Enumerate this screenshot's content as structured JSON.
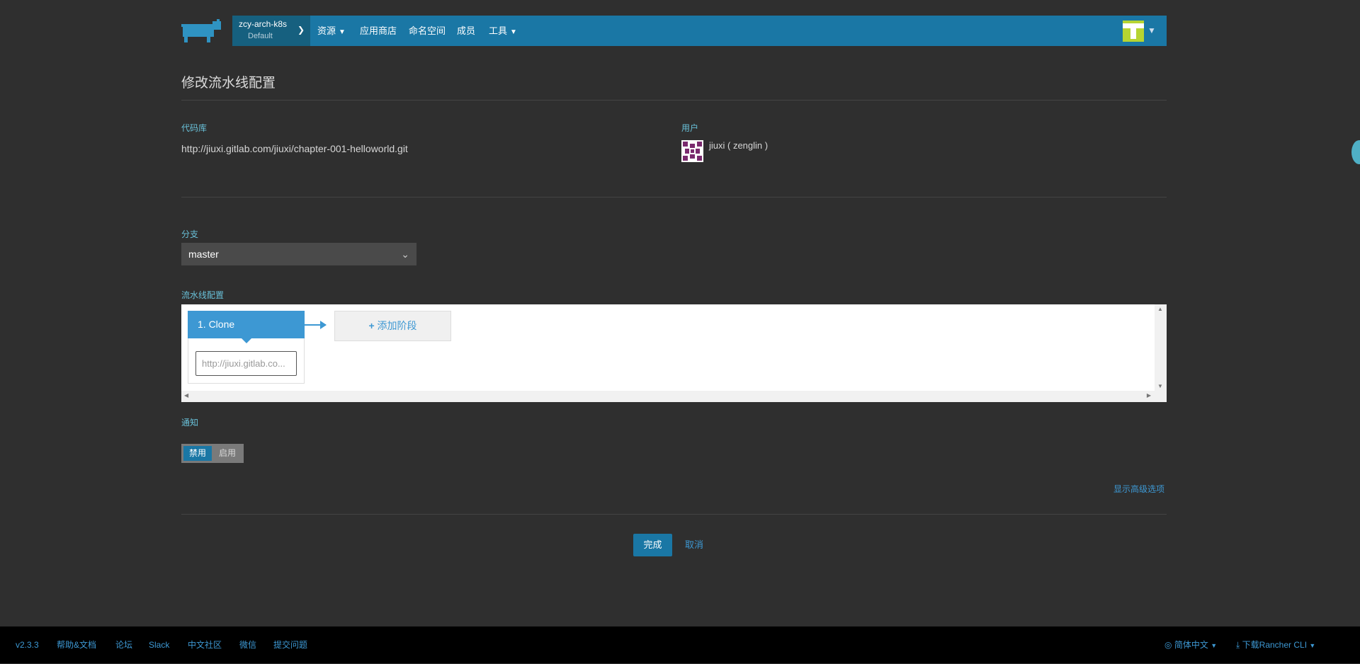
{
  "header": {
    "cluster_name": "zcy-arch-k8s",
    "project_name": "Default",
    "nav": [
      "资源",
      "应用商店",
      "命名空间",
      "成员",
      "工具"
    ]
  },
  "page": {
    "title": "修改流水线配置",
    "repo_label": "代码库",
    "repo_url": "http://jiuxi.gitlab.com/jiuxi/chapter-001-helloworld.git",
    "user_label": "用户",
    "user_value": "jiuxi ( zenglin )",
    "branch_label": "分支",
    "branch_value": "master",
    "pipeline_label": "流水线配置",
    "stage_title": "1. Clone",
    "step_placeholder": "http://jiuxi.gitlab.co...",
    "add_stage": "添加阶段",
    "notify_label": "通知",
    "notify_off": "禁用",
    "notify_on": "启用",
    "notify_selected": "禁用",
    "advanced_link": "显示高级选项",
    "done_button": "完成",
    "cancel_button": "取消"
  },
  "footer": {
    "version": "v2.3.3",
    "links": [
      "帮助&文档",
      "论坛",
      "Slack",
      "中文社区",
      "微信",
      "提交问题"
    ],
    "language": "简体中文",
    "download": "下载Rancher CLI"
  },
  "colors": {
    "primary": "#1a77a5",
    "link": "#3d98d3",
    "label": "#69c1d9",
    "background": "#2f2f2f"
  }
}
